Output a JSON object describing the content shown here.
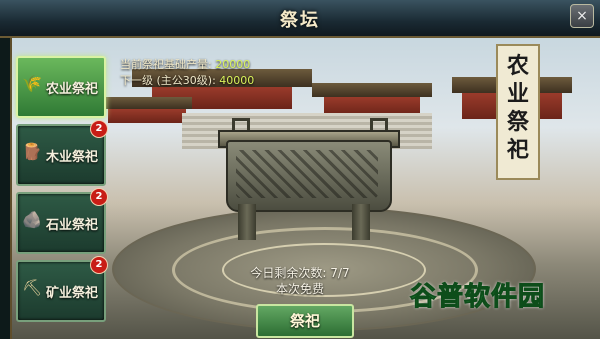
{
  "window": {
    "title": "祭坛",
    "close_glyph": "×"
  },
  "sidebar": {
    "items": [
      {
        "label": "农业祭祀",
        "icon": "wheat-icon",
        "glyph": "🌾",
        "active": true,
        "badge": ""
      },
      {
        "label": "木业祭祀",
        "icon": "wood-icon",
        "glyph": "🪵",
        "active": false,
        "badge": "2"
      },
      {
        "label": "石业祭祀",
        "icon": "stone-icon",
        "glyph": "🪨",
        "active": false,
        "badge": "2"
      },
      {
        "label": "矿业祭祀",
        "icon": "ore-icon",
        "glyph": "⛏",
        "active": false,
        "badge": "2"
      }
    ]
  },
  "info": {
    "current_label": "当前祭祀基础产量:",
    "current_value": "20000",
    "next_label": "下一级 (主公30级):",
    "next_value": "40000"
  },
  "banner": {
    "text": "农业祭祀"
  },
  "counts": {
    "remaining": "今日剩余次数: 7/7",
    "cost": "本次免费"
  },
  "actions": {
    "worship_label": "祭祀"
  },
  "watermark": {
    "text": "谷普软件园"
  }
}
